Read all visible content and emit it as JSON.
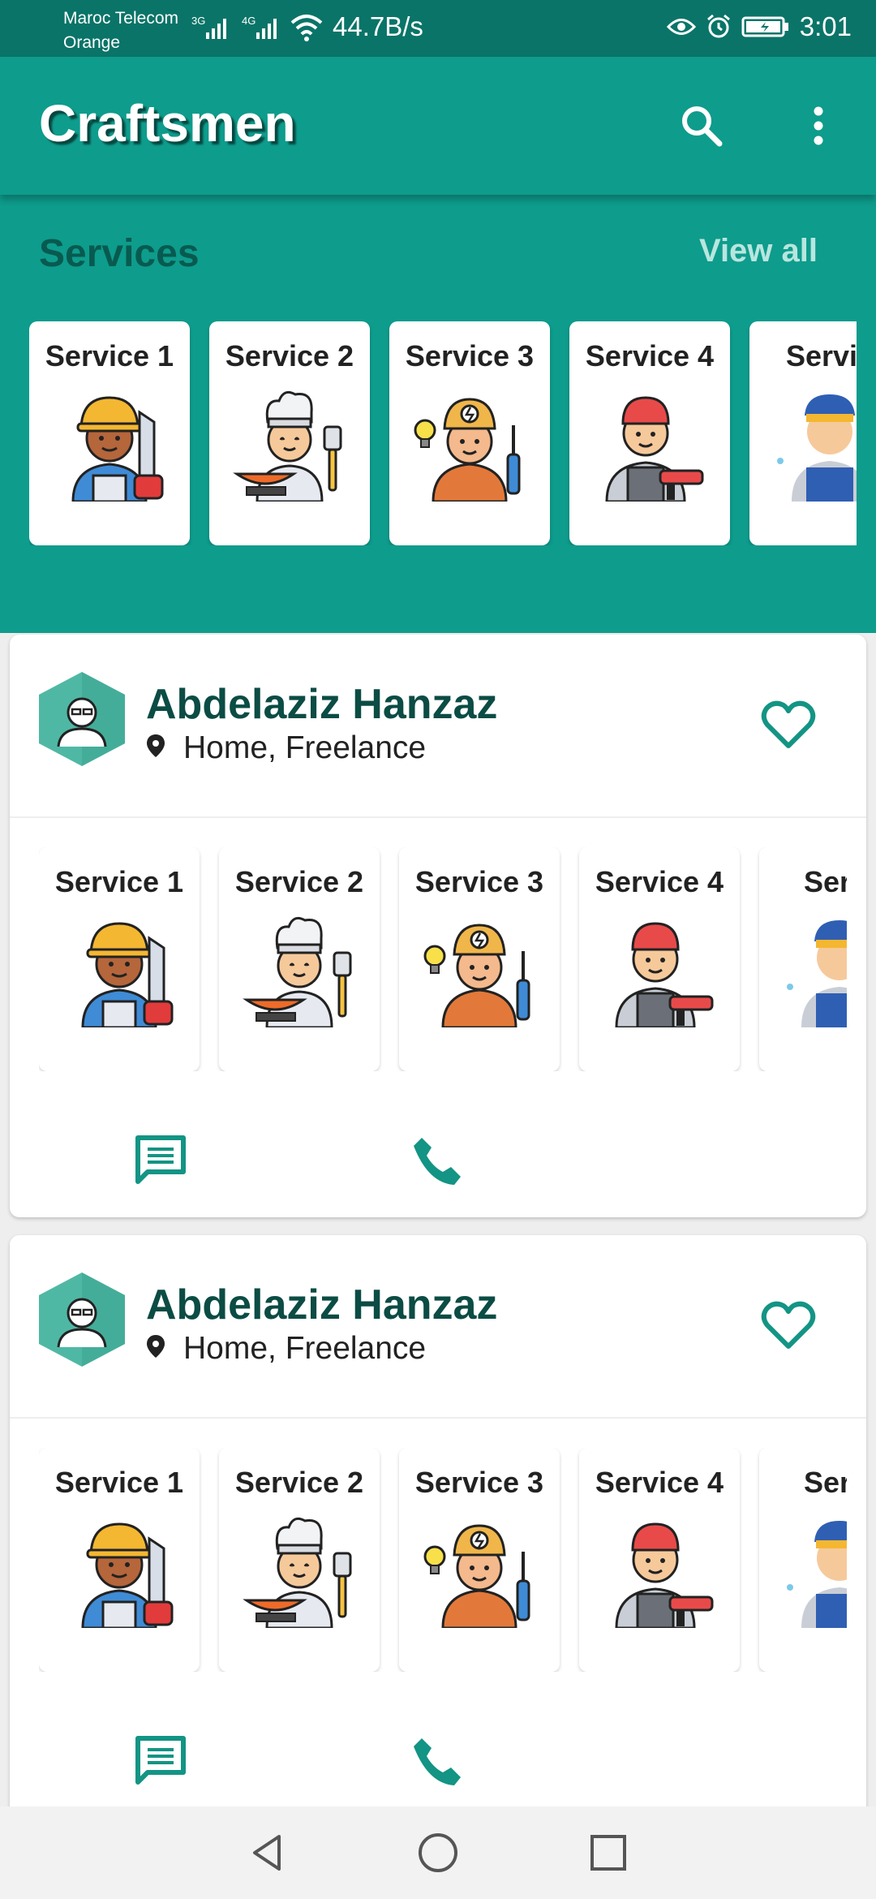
{
  "status": {
    "carrier_line1": "Maroc Telecom",
    "carrier_line2": "Orange",
    "network1": "3G",
    "network2": "4G",
    "speed": "44.7B/s",
    "time": "3:01"
  },
  "app_bar": {
    "title": "Craftsmen",
    "icons": [
      "search-icon",
      "more-vert-icon"
    ]
  },
  "services": {
    "title": "Services",
    "view_all": "View all",
    "items": [
      {
        "label": "Service 1",
        "art": "builder"
      },
      {
        "label": "Service 2",
        "art": "chef"
      },
      {
        "label": "Service 3",
        "art": "electrician"
      },
      {
        "label": "Service 4",
        "art": "painter"
      },
      {
        "label": "Servic",
        "art": "plumber"
      }
    ]
  },
  "cards": [
    {
      "name": "Abdelaziz Hanzaz",
      "location": "Home, Freelance",
      "services": [
        {
          "label": "Service 1",
          "art": "builder"
        },
        {
          "label": "Service 2",
          "art": "chef"
        },
        {
          "label": "Service 3",
          "art": "electrician"
        },
        {
          "label": "Service 4",
          "art": "painter"
        },
        {
          "label": "Servi",
          "art": "plumber"
        }
      ]
    },
    {
      "name": "Abdelaziz Hanzaz",
      "location": "Home, Freelance",
      "services": [
        {
          "label": "Service 1",
          "art": "builder"
        },
        {
          "label": "Service 2",
          "art": "chef"
        },
        {
          "label": "Service 3",
          "art": "electrician"
        },
        {
          "label": "Service 4",
          "art": "painter"
        },
        {
          "label": "Servi",
          "art": "plumber"
        }
      ]
    }
  ],
  "colors": {
    "primary": "#0e9c8c",
    "primary_dark": "#0a7468",
    "name_text": "#0b4c44",
    "accent": "#139484"
  }
}
